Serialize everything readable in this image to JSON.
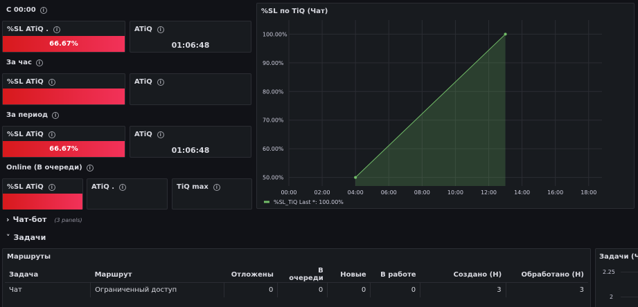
{
  "sections": {
    "since_midnight": "С 00:00",
    "per_hour": "За час",
    "per_period": "За период",
    "online": "Online (В очереди)"
  },
  "stats": {
    "sl_label": "%SL ATiQ",
    "sl_label_dot": "%SL ATiQ .",
    "atiq_label": "ATiQ",
    "atiq_label_dot": "ATiQ .",
    "tiq_max_label": "TiQ max",
    "since_midnight_sl": "66.67%",
    "since_midnight_atiq": "01:06:48",
    "per_period_sl": "66.67%",
    "per_period_atiq": "01:06:48"
  },
  "collapsed_rows": {
    "chatbot_title": "Чат-бот",
    "chatbot_count": "(3 panels)",
    "tasks_title": "Задачи"
  },
  "routes_table": {
    "title": "Маршруты",
    "columns": [
      "Задача",
      "Маршрут",
      "Отложены",
      "В очереди",
      "Новые",
      "В работе",
      "Создано (Н)",
      "Обработано (Н)"
    ],
    "rows": [
      [
        "Чат",
        "Ограниченный доступ",
        "0",
        "0",
        "0",
        "0",
        "3",
        "3"
      ]
    ]
  },
  "side_panel": {
    "title": "Задачи (Чат)",
    "tick_top": "2.25",
    "tick_bottom": "2"
  },
  "chart_data": {
    "type": "area",
    "title": "%SL по TiQ (Чат)",
    "x_ticks": [
      "00:00",
      "02:00",
      "04:00",
      "06:00",
      "08:00",
      "10:00",
      "12:00",
      "14:00",
      "16:00",
      "18:00"
    ],
    "y_ticks": [
      "100.00%",
      "90.00%",
      "80.00%",
      "70.00%",
      "60.00%",
      "50.00%"
    ],
    "x_range_hours": [
      0,
      18.8
    ],
    "y_range": [
      47,
      103
    ],
    "series": [
      {
        "name": "%SL_TiQ",
        "points": [
          [
            4.0,
            50
          ],
          [
            13.0,
            100
          ]
        ],
        "color": "#73bf69"
      }
    ],
    "legend_text": "%SL_TiQ  Last *: 100.00%",
    "grid": true,
    "legend_position": "bottom-left"
  },
  "colors": {
    "background": "#111217",
    "panel": "#181b1f",
    "stat_red_start": "#d7191c",
    "stat_red_end": "#f2325a",
    "series_green": "#73bf69"
  }
}
